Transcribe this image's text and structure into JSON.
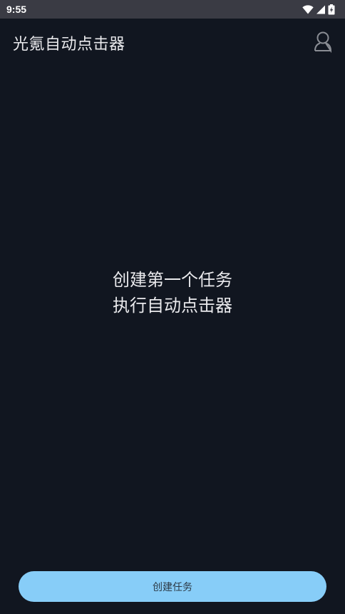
{
  "status_bar": {
    "time": "9:55",
    "icons": [
      "wifi-icon",
      "cellular-signal-icon",
      "battery-charging-icon"
    ]
  },
  "app_bar": {
    "title": "光氪自动点击器",
    "profile_icon": "user-profile-icon"
  },
  "empty_state": {
    "line1": "创建第一个任务",
    "line2": "执行自动点击器"
  },
  "actions": {
    "create_task_label": "创建任务"
  },
  "colors": {
    "background": "#111620",
    "status_bar": "#3a3b44",
    "primary_button": "#87cdf8",
    "text": "#e9e9ec"
  }
}
